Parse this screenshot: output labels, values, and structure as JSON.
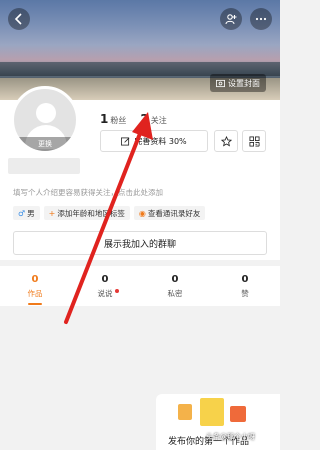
{
  "header": {
    "set_cover_label": "设置封面",
    "icons": [
      "back-icon",
      "add-user-icon",
      "more-icon",
      "image-icon"
    ]
  },
  "profile": {
    "avatar_change_label": "更换",
    "fans_count": "1",
    "fans_label": "粉丝",
    "following_count": "2",
    "following_label": "关注",
    "complete_profile_label": "完善资料 30%",
    "bio_placeholder": "填写个人介绍更容易获得关注，点击此处添加",
    "tags": {
      "gender": "男",
      "add_age": "添加年龄和地区标签",
      "contacts": "查看通讯录好友"
    },
    "group_button_label": "展示我加入的群聊"
  },
  "tabs": [
    {
      "count": "0",
      "label": "作品"
    },
    {
      "count": "0",
      "label": "说说"
    },
    {
      "count": "0",
      "label": "私密"
    },
    {
      "count": "0",
      "label": "赞"
    }
  ],
  "publish_prompt": "发布你的第一个作品",
  "watermark": "头条@那个小呀",
  "colors": {
    "accent": "#f07a1a",
    "annotation_arrow": "#e0231f"
  }
}
